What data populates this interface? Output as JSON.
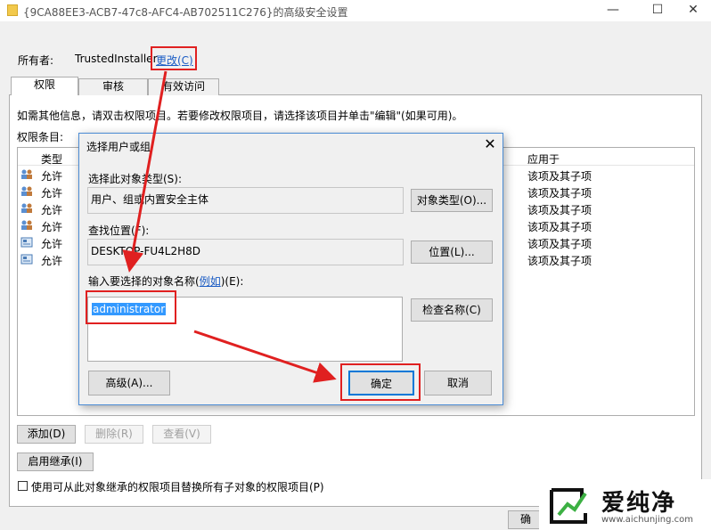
{
  "window": {
    "title": "{9CA88EE3-ACB7-47c8-AFC4-AB702511C276}的高级安全设置",
    "minimize": "—",
    "maximize": "☐",
    "close": "✕"
  },
  "owner": {
    "label": "所有者:",
    "value": "TrustedInstaller",
    "change_link": "更改(C)"
  },
  "tabs": [
    {
      "label": "权限",
      "active": true
    },
    {
      "label": "审核",
      "active": false
    },
    {
      "label": "有效访问",
      "active": false
    }
  ],
  "permissions": {
    "info_text": "如需其他信息，请双击权限项目。若要修改权限项目，请选择该项目并单击\"编辑\"(如果可用)。",
    "entries_label": "权限条目:",
    "columns": {
      "type": "类型",
      "applies_to": "应用于"
    },
    "rows": [
      {
        "type": "允许",
        "applies_to": "该项及其子项",
        "icon": "users-icon"
      },
      {
        "type": "允许",
        "applies_to": "该项及其子项",
        "icon": "users-icon"
      },
      {
        "type": "允许",
        "applies_to": "该项及其子项",
        "icon": "users-icon"
      },
      {
        "type": "允许",
        "applies_to": "该项及其子项",
        "icon": "users-icon"
      },
      {
        "type": "允许",
        "applies_to": "该项及其子项",
        "icon": "package-icon"
      },
      {
        "type": "允许",
        "applies_to": "该项及其子项",
        "icon": "package-icon"
      }
    ],
    "add_button": "添加(D)",
    "remove_button": "删除(R)",
    "view_button": "查看(V)",
    "inherit_button": "启用继承(I)",
    "replace_checkbox": "使用可从此对象继承的权限项目替换所有子对象的权限项目(P)",
    "ok_button_partial": "确"
  },
  "dialog": {
    "title": "选择用户或组",
    "close": "✕",
    "object_type_label": "选择此对象类型(S):",
    "object_type_value": "用户、组或内置安全主体",
    "object_type_button": "对象类型(O)...",
    "location_label": "查找位置(F):",
    "location_value": "DESKTOP-FU4L2H8D",
    "location_button": "位置(L)...",
    "name_label_before": "输入要选择的对象名称(",
    "name_label_example": "例如",
    "name_label_after": ")(E):",
    "name_value": "administrator",
    "check_names_button": "检查名称(C)",
    "advanced_button": "高级(A)...",
    "ok_button": "确定",
    "cancel_button": "取消"
  },
  "watermark": {
    "name": "爱纯净",
    "url": "www.aichunjing.com"
  },
  "colors": {
    "annotation_red": "#e02020",
    "link_blue": "#1b5cc4",
    "selection_blue": "#3399ff"
  }
}
